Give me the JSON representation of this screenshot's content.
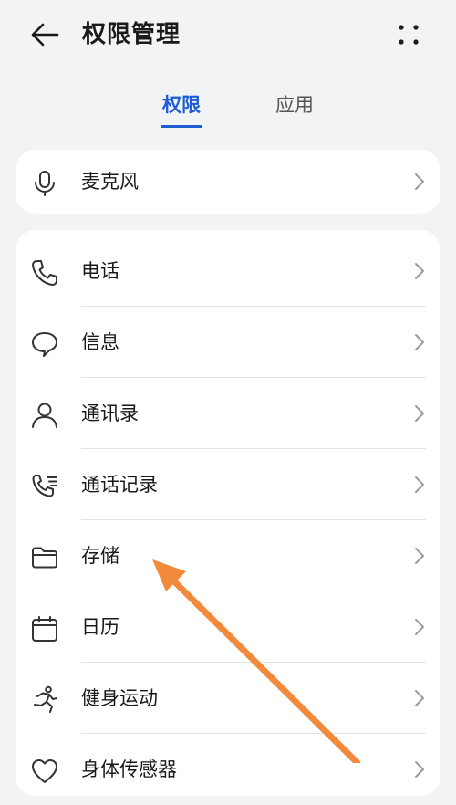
{
  "header": {
    "title": "权限管理"
  },
  "tabs": [
    {
      "label": "权限",
      "active": true
    },
    {
      "label": "应用",
      "active": false
    }
  ],
  "single_item": {
    "label": "麦克风",
    "icon": "microphone-icon"
  },
  "permissions": [
    {
      "label": "电话",
      "icon": "phone-icon"
    },
    {
      "label": "信息",
      "icon": "message-icon"
    },
    {
      "label": "通讯录",
      "icon": "contacts-icon"
    },
    {
      "label": "通话记录",
      "icon": "call-log-icon"
    },
    {
      "label": "存储",
      "icon": "folder-icon"
    },
    {
      "label": "日历",
      "icon": "calendar-icon"
    },
    {
      "label": "健身运动",
      "icon": "running-icon"
    },
    {
      "label": "身体传感器",
      "icon": "heart-icon"
    }
  ],
  "colors": {
    "accent": "#1f5dd6",
    "annotation_arrow": "#f28a3c",
    "background": "#f1f3f5"
  }
}
